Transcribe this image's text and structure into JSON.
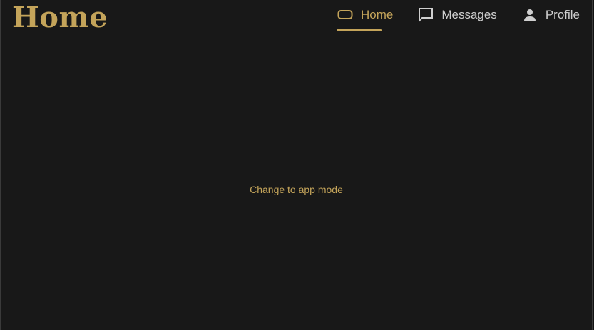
{
  "page": {
    "title": "Home"
  },
  "nav": {
    "items": [
      {
        "label": "Home",
        "icon": "home-icon",
        "active": true
      },
      {
        "label": "Messages",
        "icon": "chat-bubble-icon",
        "active": false
      },
      {
        "label": "Profile",
        "icon": "person-icon",
        "active": false
      }
    ]
  },
  "main": {
    "mode_link": "Change to app mode"
  },
  "colors": {
    "accent": "#c4a45a",
    "background": "#181818",
    "nav_text": "#cfcfcf"
  }
}
